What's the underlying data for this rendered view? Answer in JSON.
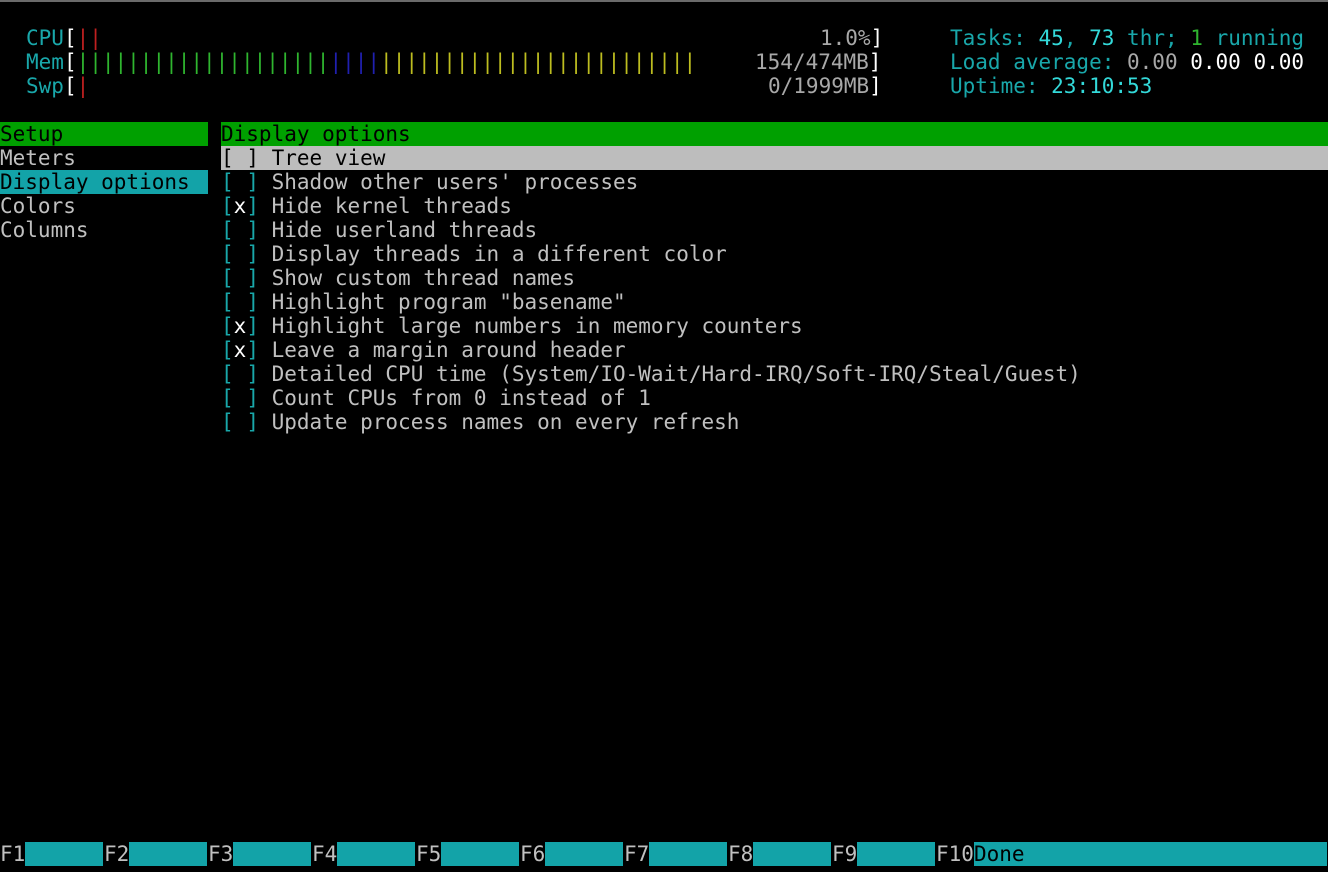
{
  "header": {
    "cpu": {
      "label": "CPU",
      "open": "[",
      "bars_red": "||",
      "value": "1.0%",
      "close": "]"
    },
    "mem": {
      "label": "Mem",
      "open": "[",
      "bars_green": "||||||||||||||||||||",
      "bars_blue": "||||",
      "bars_yellow": "|||||||||||||||||||||||||",
      "value": "154/474MB",
      "close": "]"
    },
    "swp": {
      "label": "Swp",
      "open": "[",
      "bars_red": "|",
      "value": "0/1999MB",
      "close": "]"
    },
    "tasks": {
      "label": "Tasks: ",
      "count": "45",
      "sep": ", ",
      "threads": "73",
      "thr_label": " thr; ",
      "running": "1",
      "running_label": " running"
    },
    "load": {
      "label": "Load average: ",
      "v1": "0.00",
      "v2": "0.00",
      "v3": "0.00"
    },
    "uptime": {
      "label": "Uptime: ",
      "value": "23:10:53"
    }
  },
  "sidebar": {
    "title": "Setup",
    "items": [
      "Meters",
      "Display options",
      "Colors",
      "Columns"
    ],
    "selected": "Display options"
  },
  "panel": {
    "title": "Display options",
    "options": [
      {
        "checked": " ",
        "label": "Tree view",
        "selected": true
      },
      {
        "checked": " ",
        "label": "Shadow other users' processes"
      },
      {
        "checked": "x",
        "label": "Hide kernel threads"
      },
      {
        "checked": " ",
        "label": "Hide userland threads"
      },
      {
        "checked": " ",
        "label": "Display threads in a different color"
      },
      {
        "checked": " ",
        "label": "Show custom thread names"
      },
      {
        "checked": " ",
        "label": "Highlight program \"basename\""
      },
      {
        "checked": "x",
        "label": "Highlight large numbers in memory counters"
      },
      {
        "checked": "x",
        "label": "Leave a margin around header"
      },
      {
        "checked": " ",
        "label": "Detailed CPU time (System/IO-Wait/Hard-IRQ/Soft-IRQ/Steal/Guest)"
      },
      {
        "checked": " ",
        "label": "Count CPUs from 0 instead of 1"
      },
      {
        "checked": " ",
        "label": "Update process names on every refresh"
      }
    ]
  },
  "function_keys": [
    {
      "key": "F1",
      "label": ""
    },
    {
      "key": "F2",
      "label": ""
    },
    {
      "key": "F3",
      "label": ""
    },
    {
      "key": "F4",
      "label": ""
    },
    {
      "key": "F5",
      "label": ""
    },
    {
      "key": "F6",
      "label": ""
    },
    {
      "key": "F7",
      "label": ""
    },
    {
      "key": "F8",
      "label": ""
    },
    {
      "key": "F9",
      "label": ""
    },
    {
      "key": "F10",
      "label": "Done"
    }
  ]
}
